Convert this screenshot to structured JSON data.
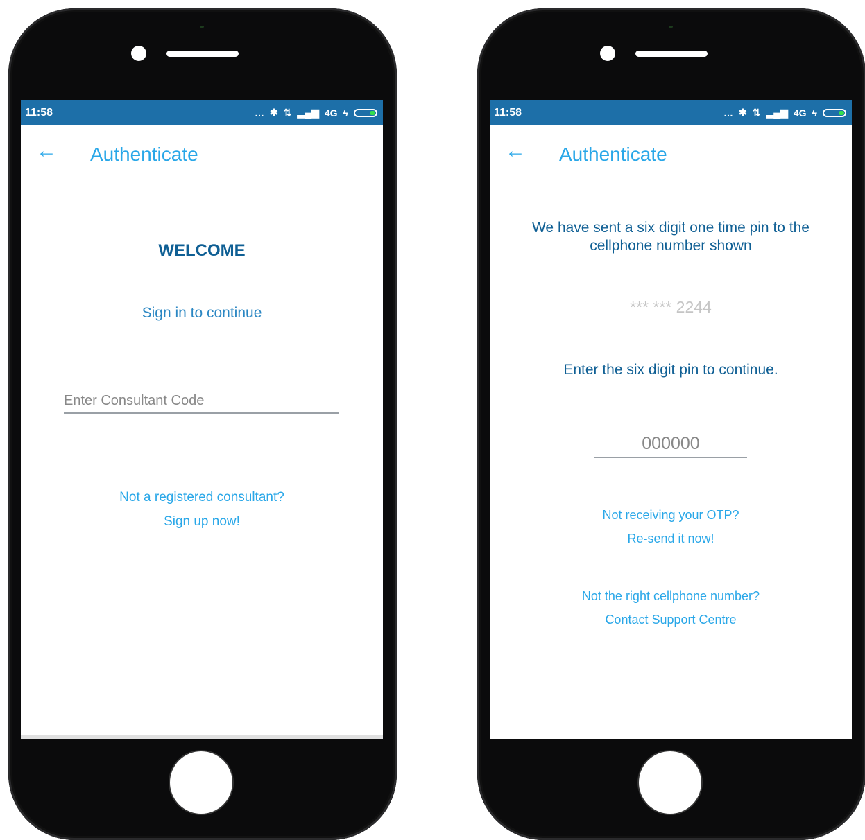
{
  "left_phone": {
    "status_bar": {
      "time": "11:58",
      "network": "4G"
    },
    "header": {
      "title": "Authenticate"
    },
    "welcome": "WELCOME",
    "subtitle": "Sign in to continue",
    "consultant_input": {
      "placeholder": "Enter Consultant Code",
      "value": ""
    },
    "register_prompt": "Not a registered consultant?",
    "signup_link": "Sign up now!"
  },
  "right_phone": {
    "status_bar": {
      "time": "11:58",
      "network": "4G"
    },
    "header": {
      "title": "Authenticate"
    },
    "otp_info": "We have sent a six digit one time pin to the cellphone number shown",
    "masked_number": "*** *** 2244",
    "enter_pin_text": "Enter the six digit pin to continue.",
    "pin_input": {
      "placeholder": "000000",
      "value": ""
    },
    "otp_prompt": "Not receiving your OTP?",
    "resend_link": "Re-send it now!",
    "wrong_number_prompt": "Not the right cellphone number?",
    "support_link": "Contact Support Centre"
  },
  "colors": {
    "status_bar": "#1d6fa8",
    "accent": "#29a7e8",
    "heading": "#0f5f94"
  },
  "icons": {
    "back": "arrow-left-icon",
    "bluetooth": "bluetooth-icon",
    "signal": "signal-icon",
    "battery": "battery-charging-icon"
  }
}
